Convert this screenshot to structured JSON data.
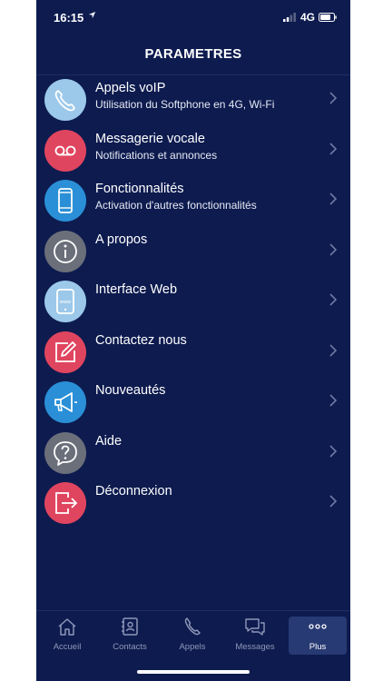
{
  "statusbar": {
    "time": "16:15",
    "location_icon": "location-arrow-icon",
    "network": "4G"
  },
  "header": {
    "title": "PARAMETRES"
  },
  "colors": {
    "background": "#0d1b4f",
    "lightblue": "#9cc8ea",
    "pink": "#e0455f",
    "blue": "#2a8fd6",
    "gray": "#6b6f7a"
  },
  "menu": [
    {
      "title": "Appels voIP",
      "subtitle": "Utilisation du Softphone en 4G, Wi-Fi",
      "icon": "phone-icon"
    },
    {
      "title": "Messagerie vocale",
      "subtitle": "Notifications et annonces",
      "icon": "voicemail-icon"
    },
    {
      "title": "Fonctionnalités",
      "subtitle": "Activation d'autres fonctionnalités",
      "icon": "smartphone-icon"
    },
    {
      "title": "A propos",
      "subtitle": "",
      "icon": "info-icon"
    },
    {
      "title": "Interface Web",
      "subtitle": "",
      "icon": "web-icon"
    },
    {
      "title": "Contactez nous",
      "subtitle": "",
      "icon": "edit-icon"
    },
    {
      "title": "Nouveautés",
      "subtitle": "",
      "icon": "megaphone-icon"
    },
    {
      "title": "Aide",
      "subtitle": "",
      "icon": "help-icon"
    },
    {
      "title": "Déconnexion",
      "subtitle": "",
      "icon": "logout-icon"
    }
  ],
  "tabs": [
    {
      "label": "Accueil",
      "icon": "home-icon"
    },
    {
      "label": "Contacts",
      "icon": "contacts-icon"
    },
    {
      "label": "Appels",
      "icon": "phone-icon"
    },
    {
      "label": "Messages",
      "icon": "messages-icon"
    },
    {
      "label": "Plus",
      "icon": "more-icon",
      "active": true
    }
  ]
}
